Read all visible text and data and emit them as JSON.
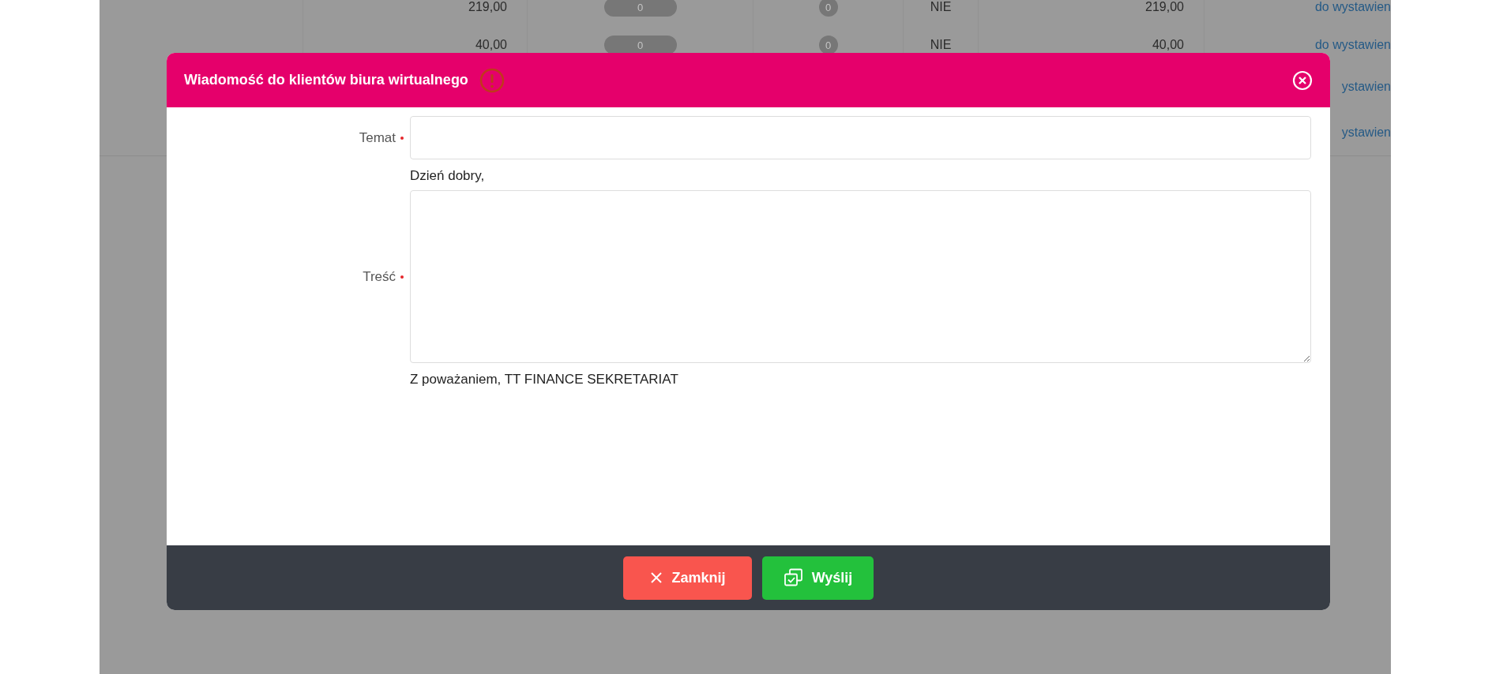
{
  "background_table": {
    "rows": [
      {
        "amount": "219,00",
        "pill": "0",
        "badge": "0",
        "flag": "NIE",
        "total": "219,00",
        "status": "do wystawien"
      },
      {
        "amount": "40,00",
        "pill": "0",
        "badge": "0",
        "flag": "NIE",
        "total": "40,00",
        "status": "do wystawien"
      },
      {
        "status": "ystawien"
      },
      {
        "status": "ystawien"
      }
    ]
  },
  "dialog": {
    "title": "Wiadomość do klientów biura wirtualnego",
    "fields": [
      {
        "kind": "input",
        "label": "Temat",
        "required": true
      },
      {
        "kind": "textarea",
        "label": "Treść",
        "required": true,
        "before": "Dzień dobry,",
        "after": "Z poważaniem, TT FINANCE SEKRETARIAT"
      }
    ],
    "buttons": [
      {
        "kind": "close",
        "label": "Zamknij"
      },
      {
        "kind": "send",
        "label": "Wyślij"
      }
    ]
  }
}
